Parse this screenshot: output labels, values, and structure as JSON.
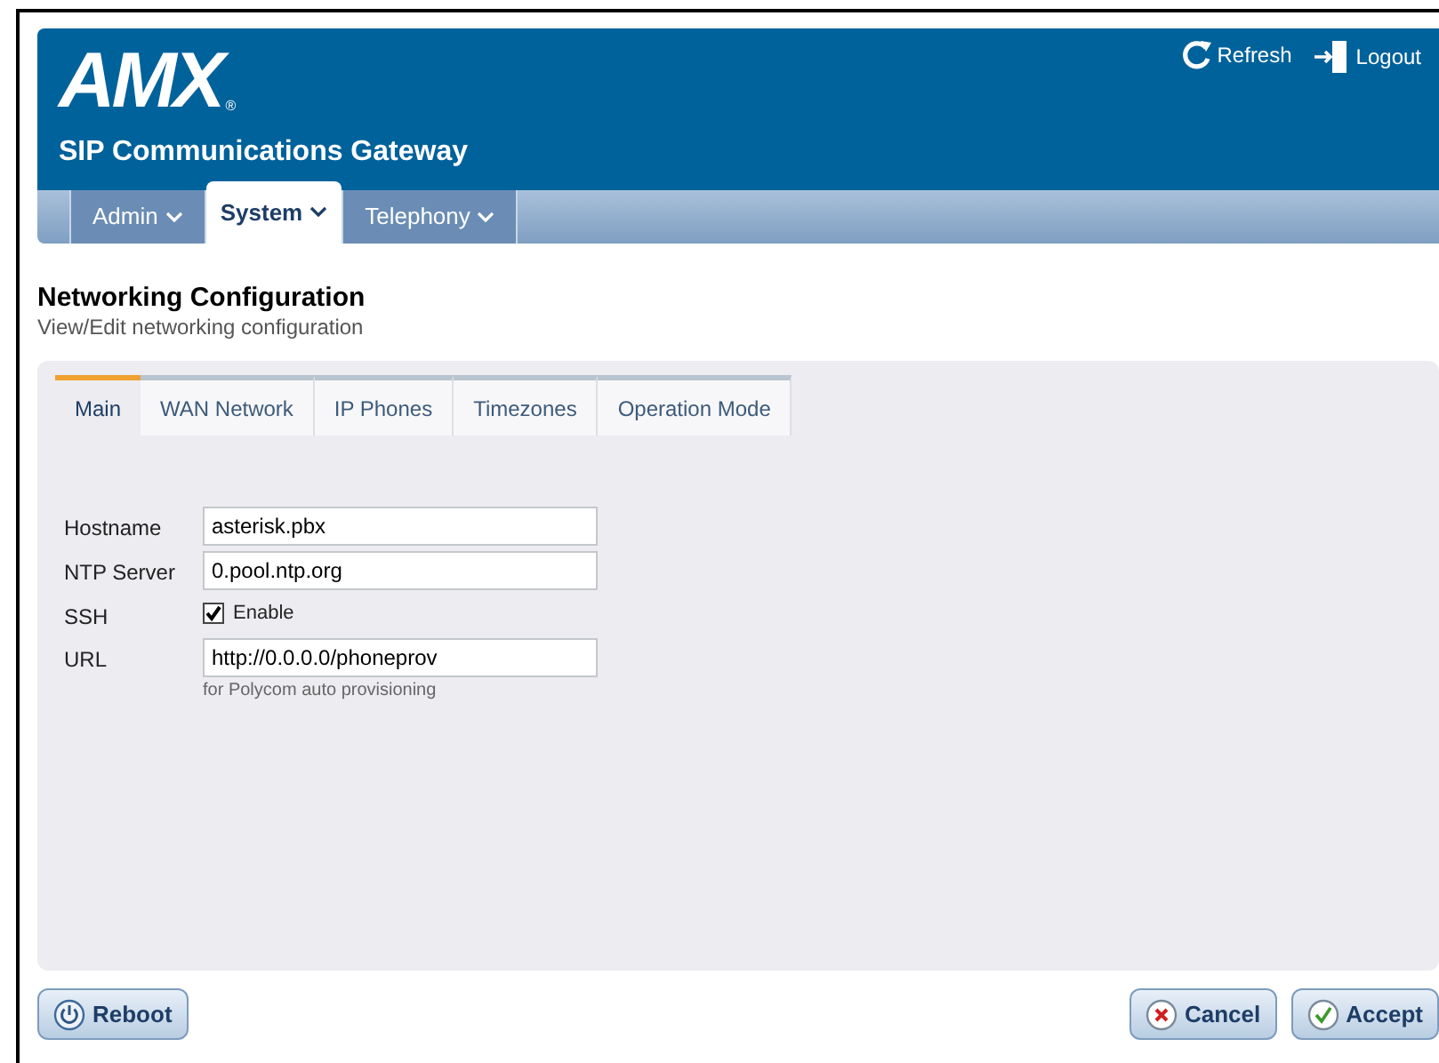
{
  "header": {
    "logo": "AMX",
    "logo_mark": "®",
    "product": "SIP Communications Gateway",
    "actions": [
      {
        "kind": "refresh",
        "label": "Refresh"
      },
      {
        "kind": "logout",
        "label": "Logout"
      }
    ]
  },
  "nav": [
    {
      "label": "Admin",
      "selected": false
    },
    {
      "label": "System",
      "selected": true
    },
    {
      "label": "Telephony",
      "selected": false
    }
  ],
  "page": {
    "title": "Networking Configuration",
    "subtitle": "View/Edit networking configuration"
  },
  "tabs": [
    {
      "label": "Main",
      "selected": true
    },
    {
      "label": "WAN Network",
      "selected": false
    },
    {
      "label": "IP Phones",
      "selected": false
    },
    {
      "label": "Timezones",
      "selected": false
    },
    {
      "label": "Operation Mode",
      "selected": false
    }
  ],
  "form": [
    {
      "kind": "text",
      "label": "Hostname",
      "value": "asterisk.pbx"
    },
    {
      "kind": "text",
      "label": "NTP Server",
      "value": "0.pool.ntp.org"
    },
    {
      "kind": "checkbox",
      "label": "SSH",
      "option": "Enable",
      "checked": true
    },
    {
      "kind": "text",
      "label": "URL",
      "value": "http://0.0.0.0/phoneprov",
      "hint": "for Polycom auto provisioning"
    }
  ],
  "buttons": [
    {
      "kind": "reboot",
      "label": "Reboot"
    },
    {
      "kind": "cancel",
      "label": "Cancel"
    },
    {
      "kind": "accept",
      "label": "Accept"
    }
  ]
}
